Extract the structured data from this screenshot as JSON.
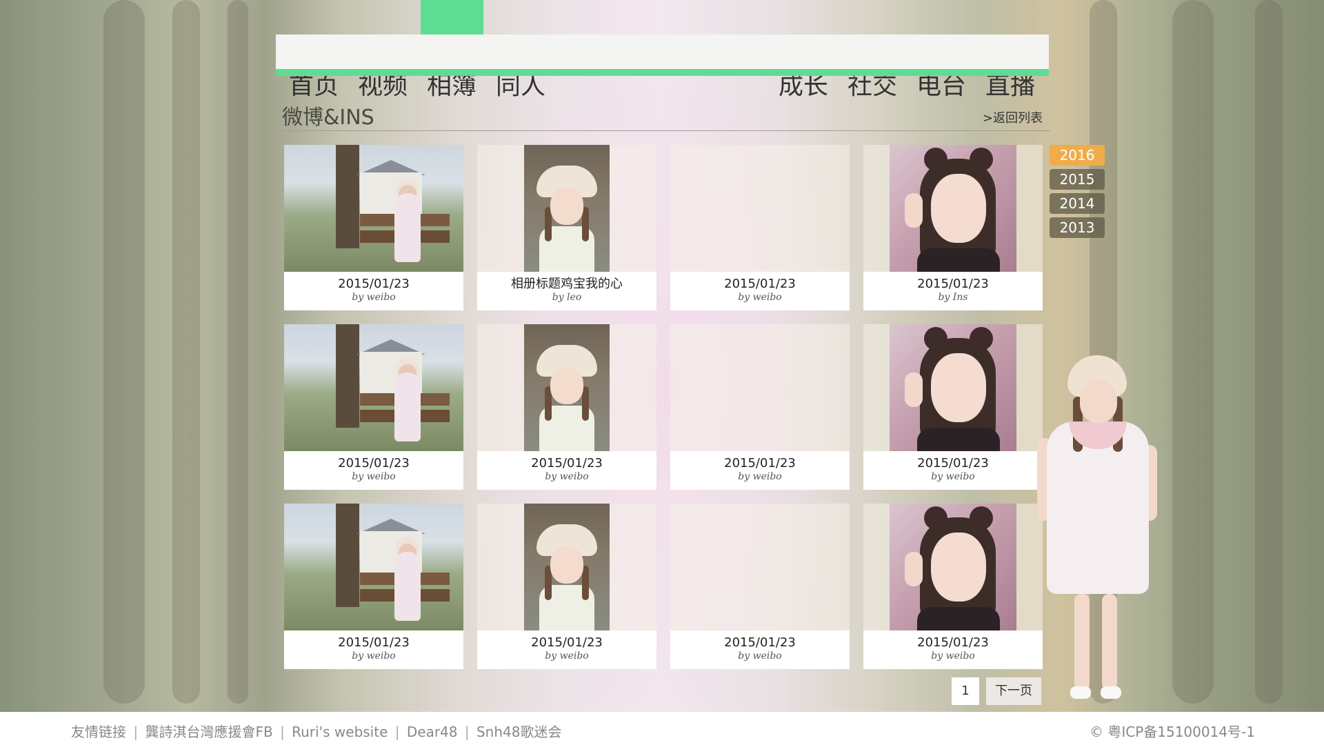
{
  "nav": {
    "left": [
      "首页",
      "视频",
      "相簿",
      "同人"
    ],
    "right": [
      "成长",
      "社交",
      "电台",
      "直播"
    ],
    "active": "相簿",
    "accent_color": "#5edc93"
  },
  "section": {
    "title": "微博&INS",
    "back_link": ">返回列表"
  },
  "albums": [
    {
      "title": "2015/01/23",
      "by": "by weibo",
      "thumb": "bench"
    },
    {
      "title": "相册标题鸡宝我的心",
      "by": "by leo",
      "thumb": "hat"
    },
    {
      "title": "2015/01/23",
      "by": "by weibo",
      "thumb": "blank"
    },
    {
      "title": "2015/01/23",
      "by": "by Ins",
      "thumb": "cat"
    },
    {
      "title": "2015/01/23",
      "by": "by weibo",
      "thumb": "bench"
    },
    {
      "title": "2015/01/23",
      "by": "by weibo",
      "thumb": "hat"
    },
    {
      "title": "2015/01/23",
      "by": "by weibo",
      "thumb": "blank"
    },
    {
      "title": "2015/01/23",
      "by": "by weibo",
      "thumb": "cat"
    },
    {
      "title": "2015/01/23",
      "by": "by weibo",
      "thumb": "bench"
    },
    {
      "title": "2015/01/23",
      "by": "by weibo",
      "thumb": "hat"
    },
    {
      "title": "2015/01/23",
      "by": "by weibo",
      "thumb": "blank"
    },
    {
      "title": "2015/01/23",
      "by": "by weibo",
      "thumb": "cat"
    }
  ],
  "years": [
    "2016",
    "2015",
    "2014",
    "2013"
  ],
  "active_year": "2016",
  "year_active_color": "#f0ac4a",
  "pagination": {
    "current": "1",
    "next_label": "下一页"
  },
  "footer": {
    "links": [
      "友情链接",
      "龔詩淇台灣應援會FB",
      "Ruri's website",
      "Dear48",
      "Snh48歌迷会"
    ],
    "separator": "|",
    "copyright": "© 粤ICP备15100014号-1"
  }
}
